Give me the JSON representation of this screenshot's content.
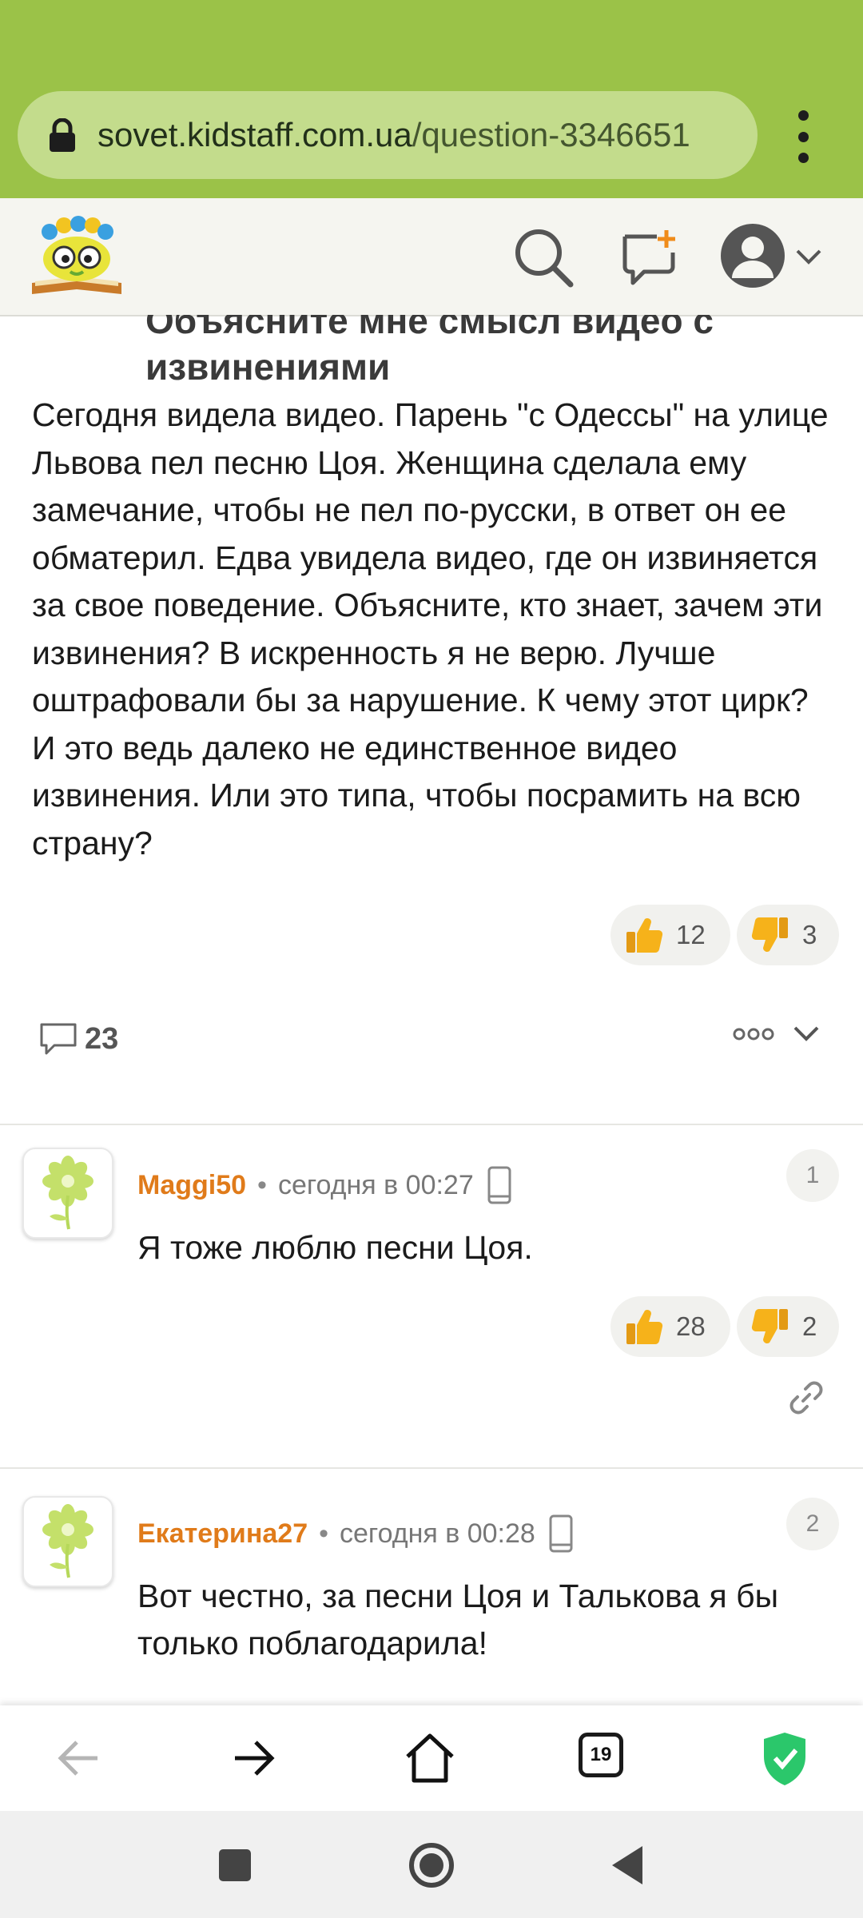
{
  "browser": {
    "url_host": "sovet.kidstaff.com.ua",
    "url_path": "/question-3346651",
    "tabs_count": "19",
    "shield_color": "#2bc76b"
  },
  "site": {
    "logo": "kidstaff-logo",
    "icons": [
      "search-icon",
      "new-question-icon",
      "user-avatar-icon",
      "chevron-down-icon"
    ]
  },
  "question": {
    "title": "Объясните мне смысл видео с извинениями",
    "body": "Сегодня видела видео. Парень \"с Одессы\" на улице Львова пел песню Цоя. Женщина сделала ему замечание, чтобы не пел по-русски, в ответ он ее обматерил. Едва увидела видео, где он извиняется за свое поведение. Объясните, кто знает, зачем эти извинения? В искренность я не верю. Лучше оштрафовали бы за нарушение. К чему этот цирк? И это ведь далеко не единственное видео извинения. Или это типа, чтобы посрамить на всю страну?",
    "likes": "12",
    "dislikes": "3",
    "comments_count": "23"
  },
  "comments": [
    {
      "author": "Maggi50",
      "time": "сегодня в 00:27",
      "number": "1",
      "text": "Я тоже люблю песни Цоя.",
      "likes": "28",
      "dislikes": "2"
    },
    {
      "author": "Екатерина27",
      "time": "сегодня в 00:28",
      "number": "2",
      "text": "Вот честно, за песни Цоя и Талькова я бы только поблагодарила!"
    }
  ],
  "colors": {
    "chrome_green": "#9bc248",
    "author_orange": "#e07b1a",
    "thumb_yellow": "#f6b21a"
  }
}
